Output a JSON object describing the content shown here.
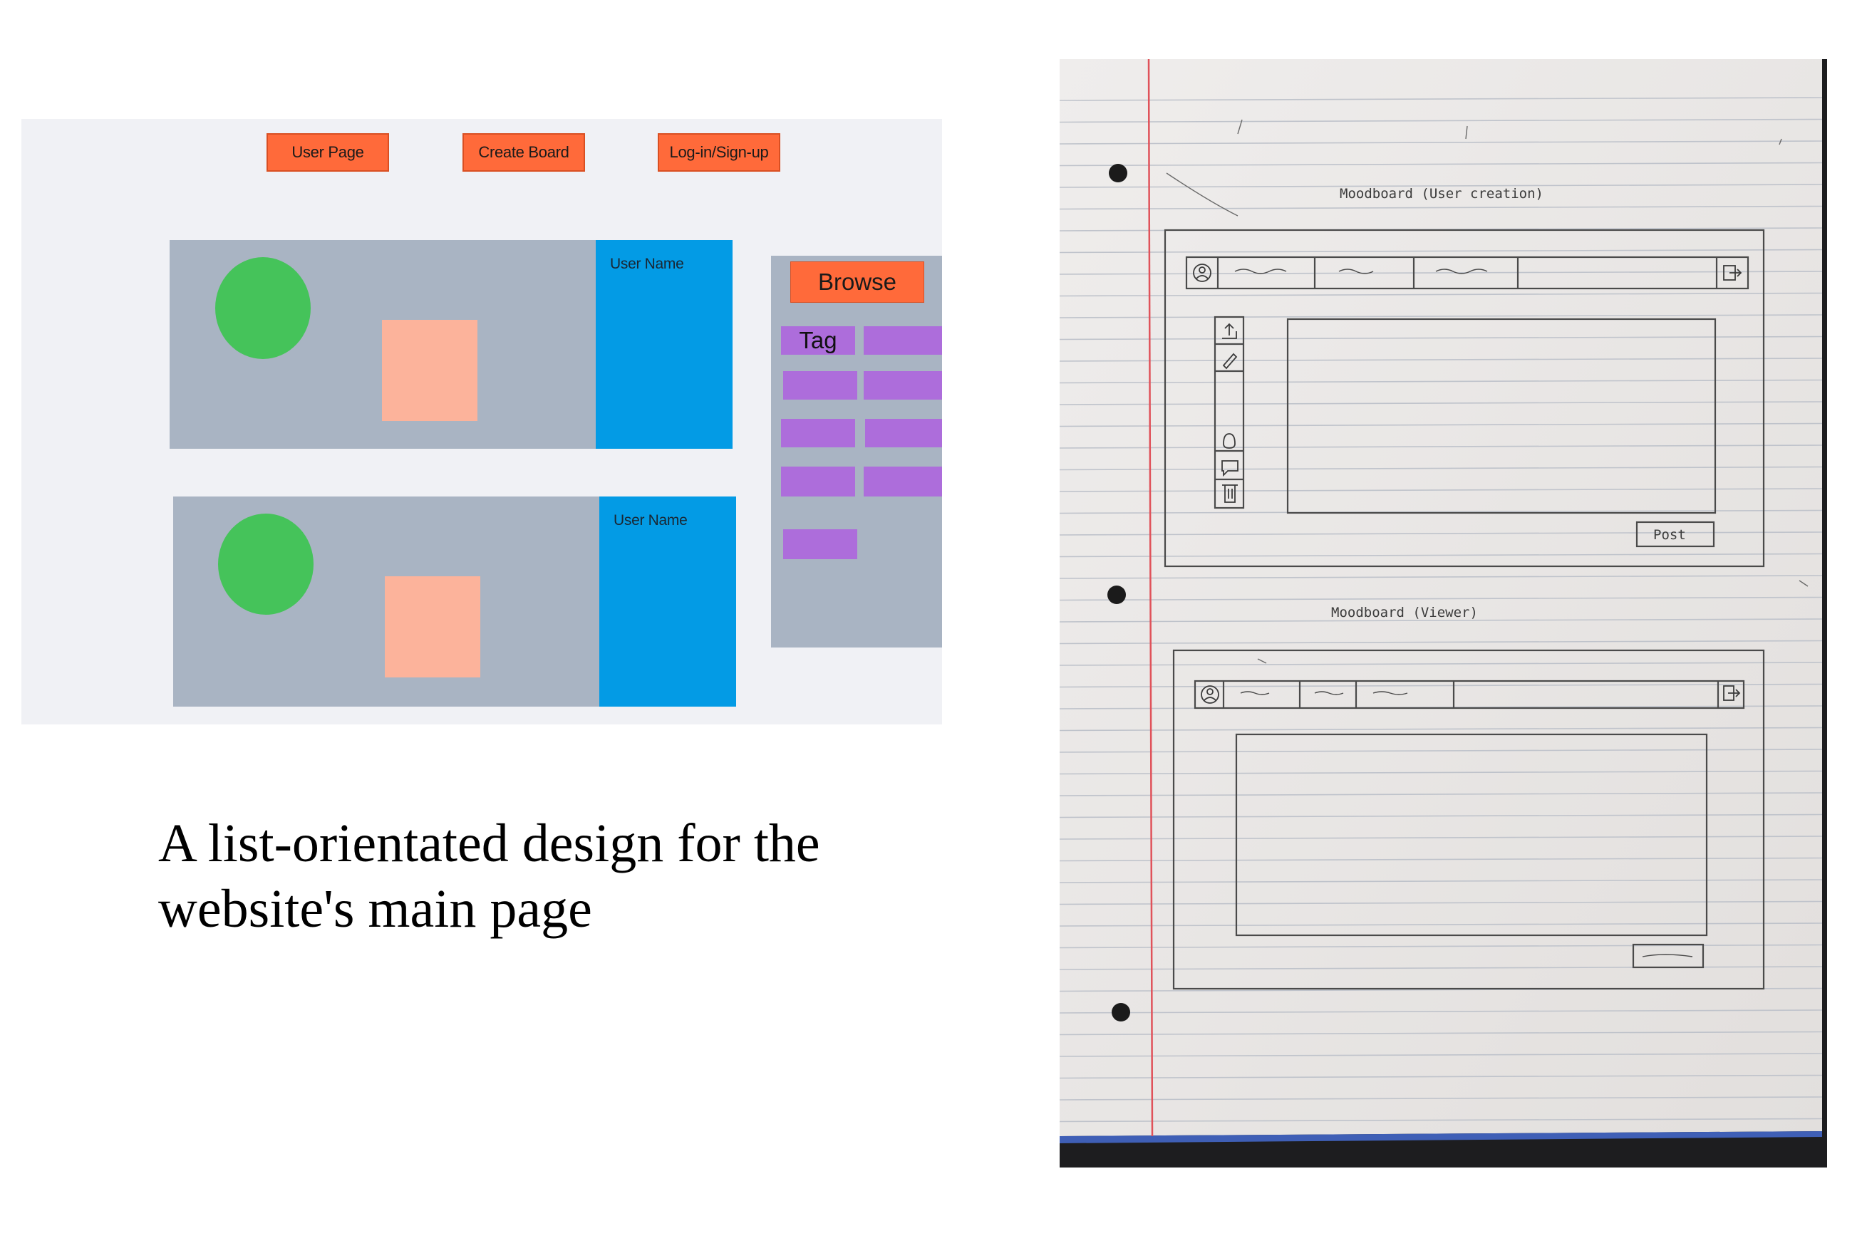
{
  "mockup": {
    "nav": {
      "user_page": "User Page",
      "create_board": "Create Board",
      "login_signup": "Log-in/Sign-up"
    },
    "posts": [
      {
        "user_name": "User Name"
      },
      {
        "user_name": "User Name"
      }
    ],
    "sidebar": {
      "browse_label": "Browse",
      "tag_label": "Tag"
    },
    "colors": {
      "background": "#f0f1f5",
      "nav_button": "#ff6a3a",
      "card": "#a9b4c3",
      "avatar": "#45c35a",
      "thumbnail": "#fcb39b",
      "user_panel": "#039be5",
      "tag": "#ad6ddb"
    }
  },
  "caption": "A list-orientated design for the website's main page",
  "sketch": {
    "title_user": "Moodboard (User creation)",
    "title_viewer": "Moodboard (Viewer)",
    "post_label": "Post",
    "icons": [
      "user-icon",
      "exit-icon",
      "upload-icon",
      "pencil-icon",
      "hand-icon",
      "comment-icon",
      "trash-icon"
    ]
  }
}
